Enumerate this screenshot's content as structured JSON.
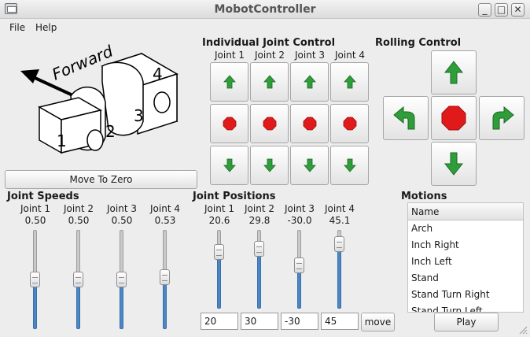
{
  "window": {
    "title": "MobotController"
  },
  "menu": [
    "File",
    "Help"
  ],
  "diagram": {
    "forward_label": "Forward",
    "joint_numbers": [
      "1",
      "2",
      "3",
      "4"
    ]
  },
  "move_to_zero_label": "Move To Zero",
  "individual_joint_control": {
    "title": "Individual Joint Control",
    "joints": [
      "Joint 1",
      "Joint 2",
      "Joint 3",
      "Joint 4"
    ],
    "colors": {
      "up": "#2e9d3a",
      "stop": "#e01a1a",
      "down": "#2e9d3a"
    }
  },
  "rolling_control": {
    "title": "Rolling Control"
  },
  "joint_speeds": {
    "title": "Joint Speeds",
    "joints": [
      {
        "label": "Joint 1",
        "value": "0.50",
        "level": 0.5
      },
      {
        "label": "Joint 2",
        "value": "0.50",
        "level": 0.5
      },
      {
        "label": "Joint 3",
        "value": "0.50",
        "level": 0.5
      },
      {
        "label": "Joint 4",
        "value": "0.53",
        "level": 0.53
      }
    ]
  },
  "joint_positions": {
    "title": "Joint Positions",
    "joints": [
      {
        "label": "Joint 1",
        "value": "20.6",
        "input": "20",
        "level": 0.78
      },
      {
        "label": "Joint 2",
        "value": "29.8",
        "input": "30",
        "level": 0.83
      },
      {
        "label": "Joint 3",
        "value": "-30.0",
        "input": "-30",
        "level": 0.56
      },
      {
        "label": "Joint 4",
        "value": "45.1",
        "input": "45",
        "level": 0.9
      }
    ],
    "move_label": "move"
  },
  "motions": {
    "title": "Motions",
    "column": "Name",
    "items": [
      "Arch",
      "Inch Right",
      "Inch Left",
      "Stand",
      "Stand Turn Right",
      "Stand Turn Left"
    ],
    "play_label": "Play"
  }
}
